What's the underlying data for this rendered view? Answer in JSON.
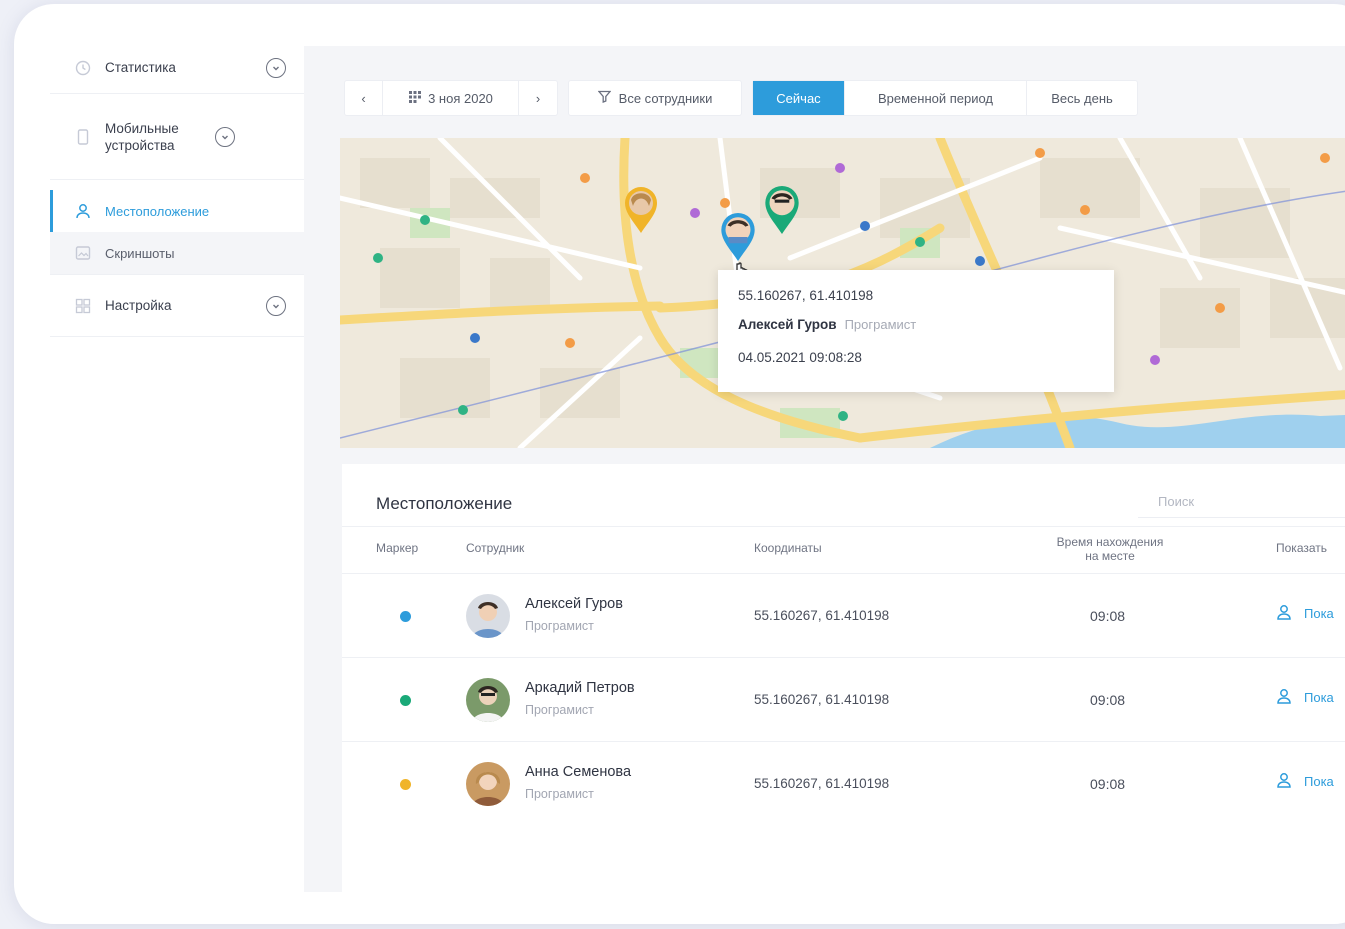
{
  "sidebar": {
    "items": [
      {
        "label": "Статистика",
        "icon": "clock-icon"
      },
      {
        "label": "Мобильные устройства",
        "icon": "phone-icon"
      },
      {
        "label": "Местоположение",
        "icon": "user-icon",
        "active": true
      },
      {
        "label": "Скриншоты",
        "icon": "image-icon"
      },
      {
        "label": "Настройка",
        "icon": "grid-icon"
      }
    ]
  },
  "toolbar": {
    "prev": "‹",
    "date": "3 ноя 2020",
    "next": "›",
    "filter": "Все сотрудники",
    "tabs": [
      "Сейчас",
      "Временной период",
      "Весь день"
    ],
    "active_tab": "Сейчас"
  },
  "map": {
    "popup": {
      "coords": "55.160267, 61.410198",
      "name": "Алексей Гуров",
      "role": "Програмист",
      "timestamp": "04.05.2021 09:08:28"
    }
  },
  "table": {
    "title": "Местоположение",
    "search_placeholder": "Поиск",
    "headers": {
      "marker": "Маркер",
      "employee": "Сотрудник",
      "coords": "Координаты",
      "time_line1": "Время нахождения",
      "time_line2": "на месте",
      "show": "Показать"
    },
    "rows": [
      {
        "name": "Алексей Гуров",
        "role": "Програмист",
        "coords": "55.160267, 61.410198",
        "time": "09:08",
        "show": "Пока",
        "marker_color": "#2d9cdb"
      },
      {
        "name": "Аркадий Петров",
        "role": "Програмист",
        "coords": "55.160267, 61.410198",
        "time": "09:08",
        "show": "Пока",
        "marker_color": "#1aa978"
      },
      {
        "name": "Анна Семенова",
        "role": "Програмист",
        "coords": "55.160267, 61.410198",
        "time": "09:08",
        "show": "Пока",
        "marker_color": "#f0b429"
      }
    ]
  },
  "colors": {
    "accent": "#2d9cdb",
    "green": "#1aa978",
    "yellow": "#f0b429"
  }
}
